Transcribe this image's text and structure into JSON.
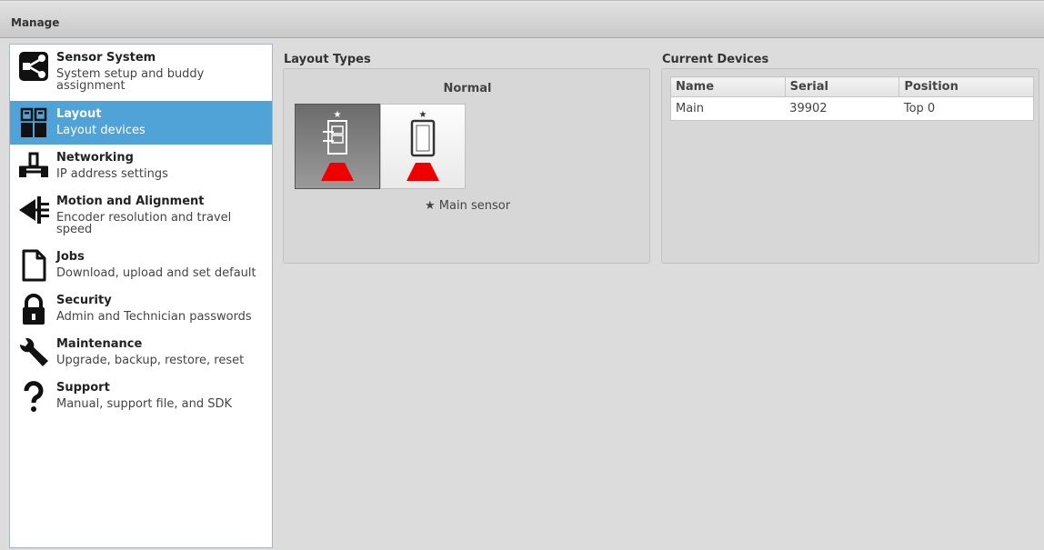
{
  "window": {
    "title": "Manage"
  },
  "sidebar": {
    "items": [
      {
        "name": "Sensor System",
        "desc": "System setup and buddy assignment",
        "icon": "sensor-system-icon"
      },
      {
        "name": "Layout",
        "desc": "Layout devices",
        "icon": "layout-icon",
        "selected": true
      },
      {
        "name": "Networking",
        "desc": "IP address settings",
        "icon": "networking-icon"
      },
      {
        "name": "Motion and Alignment",
        "desc": "Encoder resolution and travel speed",
        "icon": "motion-alignment-icon"
      },
      {
        "name": "Jobs",
        "desc": "Download, upload and set default",
        "icon": "jobs-icon"
      },
      {
        "name": "Security",
        "desc": "Admin and Technician passwords",
        "icon": "lock-icon"
      },
      {
        "name": "Maintenance",
        "desc": "Upgrade, backup, restore, reset",
        "icon": "wrench-icon"
      },
      {
        "name": "Support",
        "desc": "Manual, support file, and SDK",
        "icon": "question-icon"
      }
    ]
  },
  "layout_types": {
    "heading": "Layout Types",
    "mode_label": "Normal",
    "legend": "★ Main sensor"
  },
  "current_devices": {
    "heading": "Current Devices",
    "columns": [
      "Name",
      "Serial",
      "Position"
    ],
    "rows": [
      {
        "name": "Main",
        "serial": "39902",
        "position": "Top 0"
      }
    ]
  },
  "colors": {
    "accent": "#4fa3d6",
    "laser": "#ee0000"
  }
}
